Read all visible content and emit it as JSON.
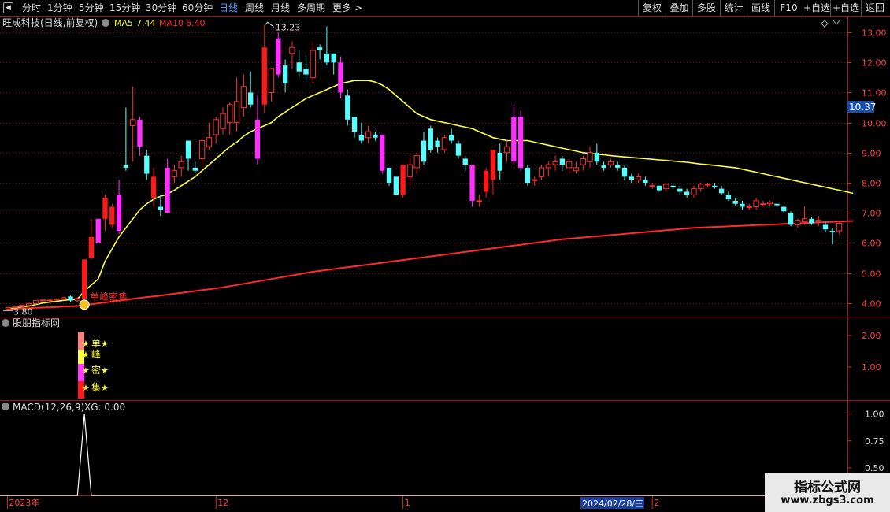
{
  "toolbar": {
    "periods": [
      "分时",
      "1分钟",
      "5分钟",
      "15分钟",
      "30分钟",
      "60分钟",
      "日线",
      "周线",
      "月线",
      "多周期",
      "更多"
    ],
    "active_period": "日线",
    "more_arrow": ">",
    "right_buttons": [
      "复权",
      "叠加",
      "多股",
      "统计",
      "画线",
      "F10",
      "+自选",
      "返回"
    ]
  },
  "chart_data": [
    {
      "type": "candlestick",
      "title": "旺成科技(日线,前复权)",
      "indicators": [
        {
          "name": "MA5",
          "value": "7.44",
          "color": "#ffff40"
        },
        {
          "name": "MA10",
          "value": "6.40",
          "color": "#ff3030"
        }
      ],
      "ylim": [
        3.6,
        13.5
      ],
      "y_ticks": [
        "13.00",
        "12.00",
        "11.00",
        "10.00",
        "9.00",
        "8.00",
        "7.00",
        "6.00",
        "5.00",
        "4.00"
      ],
      "current_price": "10.37",
      "annotations": {
        "high": "13.23",
        "low": "3.80",
        "signal": "单峰密集"
      },
      "candles": [
        [
          3.8,
          3.85,
          3.75,
          3.85
        ],
        [
          3.85,
          3.9,
          3.8,
          3.88
        ],
        [
          3.88,
          3.95,
          3.85,
          3.93
        ],
        [
          3.93,
          4.0,
          3.9,
          3.98
        ],
        [
          3.98,
          4.1,
          3.95,
          4.08
        ],
        [
          4.08,
          4.12,
          4.05,
          4.1
        ],
        [
          4.1,
          4.12,
          4.08,
          4.1
        ],
        [
          4.12,
          4.15,
          4.08,
          4.14
        ],
        [
          4.14,
          4.2,
          4.1,
          4.18
        ],
        [
          4.22,
          4.25,
          4.05,
          4.08
        ],
        [
          4.08,
          4.2,
          4.05,
          4.15
        ],
        [
          4.15,
          5.45,
          4.05,
          5.45
        ],
        [
          5.5,
          6.8,
          5.45,
          6.2
        ],
        [
          6.8,
          6.8,
          6.0,
          6.0
        ],
        [
          6.8,
          7.6,
          6.4,
          7.5
        ],
        [
          6.6,
          7.3,
          6.5,
          7.2
        ],
        [
          7.6,
          8.1,
          6.3,
          6.4
        ],
        [
          8.6,
          10.5,
          8.4,
          8.5
        ],
        [
          9.9,
          11.2,
          8.7,
          10.1
        ],
        [
          10.1,
          10.2,
          8.9,
          9.2
        ],
        [
          8.9,
          9.1,
          8.1,
          8.3
        ],
        [
          7.5,
          8.5,
          7.2,
          8.2
        ],
        [
          7.2,
          7.6,
          6.9,
          7.1
        ],
        [
          8.5,
          8.8,
          7.0,
          7.0
        ],
        [
          8.2,
          8.6,
          8.0,
          8.4
        ],
        [
          8.5,
          8.9,
          8.2,
          8.7
        ],
        [
          9.4,
          9.4,
          8.4,
          8.8
        ],
        [
          8.5,
          8.7,
          8.3,
          8.4
        ],
        [
          8.8,
          9.5,
          8.5,
          9.4
        ],
        [
          9.2,
          10.0,
          9.1,
          9.5
        ],
        [
          9.6,
          10.2,
          9.3,
          10.1
        ],
        [
          9.8,
          10.5,
          9.6,
          10.3
        ],
        [
          10.0,
          10.7,
          9.6,
          10.6
        ],
        [
          10.0,
          11.5,
          9.7,
          10.7
        ],
        [
          10.5,
          11.6,
          10.2,
          11.2
        ],
        [
          11.0,
          11.7,
          10.5,
          10.6
        ],
        [
          10.1,
          10.9,
          8.6,
          8.8
        ],
        [
          10.6,
          13.23,
          10.3,
          12.5
        ],
        [
          11.0,
          11.8,
          10.7,
          11.8
        ],
        [
          12.8,
          13.0,
          11.5,
          11.6
        ],
        [
          11.9,
          12.1,
          11.0,
          11.3
        ],
        [
          12.3,
          12.7,
          11.8,
          12.5
        ],
        [
          12.0,
          12.4,
          11.5,
          11.7
        ],
        [
          11.8,
          12.2,
          11.4,
          11.6
        ],
        [
          11.5,
          12.7,
          11.3,
          12.4
        ],
        [
          12.5,
          12.6,
          12.1,
          12.4
        ],
        [
          12.3,
          13.2,
          11.9,
          12.0
        ],
        [
          12.3,
          12.3,
          11.6,
          12.0
        ],
        [
          12.0,
          12.2,
          10.8,
          11.0
        ],
        [
          10.9,
          11.1,
          9.9,
          10.1
        ],
        [
          10.2,
          10.2,
          9.5,
          9.7
        ],
        [
          9.6,
          10.0,
          9.3,
          9.4
        ],
        [
          9.5,
          9.9,
          9.3,
          9.7
        ],
        [
          9.6,
          9.7,
          9.4,
          9.5
        ],
        [
          9.6,
          9.6,
          8.3,
          8.4
        ],
        [
          8.5,
          8.5,
          7.9,
          8.0
        ],
        [
          8.2,
          8.2,
          7.6,
          7.6
        ],
        [
          7.6,
          8.6,
          7.5,
          8.6
        ],
        [
          8.2,
          8.9,
          7.9,
          8.6
        ],
        [
          8.5,
          9.0,
          8.3,
          8.9
        ],
        [
          9.4,
          9.7,
          8.6,
          8.7
        ],
        [
          9.8,
          9.9,
          9.0,
          9.1
        ],
        [
          9.4,
          9.5,
          9.0,
          9.2
        ],
        [
          9.1,
          9.6,
          9.0,
          9.5
        ],
        [
          9.6,
          9.8,
          9.3,
          9.4
        ],
        [
          9.3,
          9.4,
          8.8,
          8.9
        ],
        [
          8.8,
          8.9,
          8.4,
          8.6
        ],
        [
          8.6,
          8.6,
          7.2,
          7.4
        ],
        [
          7.4,
          7.6,
          7.2,
          7.4
        ],
        [
          7.7,
          8.5,
          7.5,
          8.4
        ],
        [
          8.1,
          9.1,
          7.6,
          9.1
        ],
        [
          9.0,
          9.3,
          8.1,
          8.4
        ],
        [
          9.0,
          9.4,
          8.7,
          9.2
        ],
        [
          10.2,
          10.6,
          8.6,
          8.7
        ],
        [
          10.2,
          10.4,
          8.4,
          8.5
        ],
        [
          8.5,
          8.6,
          7.9,
          8.0
        ],
        [
          8.1,
          8.2,
          7.9,
          8.1
        ],
        [
          8.2,
          8.6,
          8.1,
          8.5
        ],
        [
          8.5,
          8.7,
          8.2,
          8.6
        ],
        [
          8.6,
          8.9,
          8.4,
          8.7
        ],
        [
          8.8,
          8.9,
          8.4,
          8.6
        ],
        [
          8.5,
          8.8,
          8.3,
          8.7
        ],
        [
          8.4,
          8.7,
          8.3,
          8.5
        ],
        [
          8.6,
          8.9,
          8.4,
          8.8
        ],
        [
          8.7,
          9.2,
          8.5,
          9.0
        ],
        [
          9.0,
          9.3,
          8.6,
          8.7
        ],
        [
          8.6,
          8.7,
          8.4,
          8.5
        ],
        [
          8.6,
          8.8,
          8.5,
          8.7
        ],
        [
          8.6,
          8.7,
          8.4,
          8.5
        ],
        [
          8.5,
          8.6,
          8.1,
          8.2
        ],
        [
          8.2,
          8.3,
          8.0,
          8.1
        ],
        [
          8.1,
          8.3,
          8.0,
          8.2
        ],
        [
          8.1,
          8.2,
          7.9,
          8.0
        ],
        [
          7.9,
          8.0,
          7.8,
          7.9
        ],
        [
          7.9,
          7.9,
          7.7,
          7.75
        ],
        [
          7.8,
          8.0,
          7.7,
          7.95
        ],
        [
          7.9,
          8.0,
          7.8,
          7.85
        ],
        [
          7.8,
          7.9,
          7.6,
          7.7
        ],
        [
          7.7,
          7.8,
          7.5,
          7.6
        ],
        [
          7.6,
          7.9,
          7.5,
          7.8
        ],
        [
          7.8,
          8.0,
          7.7,
          7.95
        ],
        [
          7.95,
          8.0,
          7.85,
          7.95
        ],
        [
          7.9,
          8.0,
          7.8,
          7.85
        ],
        [
          7.8,
          7.9,
          7.6,
          7.65
        ],
        [
          7.6,
          7.7,
          7.4,
          7.45
        ],
        [
          7.4,
          7.5,
          7.25,
          7.3
        ],
        [
          7.3,
          7.4,
          7.1,
          7.2
        ],
        [
          7.2,
          7.3,
          7.1,
          7.2
        ],
        [
          7.2,
          7.5,
          7.1,
          7.4
        ],
        [
          7.3,
          7.4,
          7.2,
          7.3
        ],
        [
          7.3,
          7.4,
          7.2,
          7.35
        ],
        [
          7.3,
          7.35,
          7.2,
          7.25
        ],
        [
          7.2,
          7.25,
          7.0,
          7.05
        ],
        [
          7.0,
          7.05,
          6.55,
          6.6
        ],
        [
          6.6,
          6.8,
          6.5,
          6.75
        ],
        [
          6.7,
          7.2,
          6.6,
          6.8
        ],
        [
          6.8,
          6.85,
          6.6,
          6.65
        ],
        [
          6.7,
          6.9,
          6.55,
          6.75
        ],
        [
          6.6,
          6.7,
          6.35,
          6.45
        ],
        [
          6.4,
          6.5,
          5.95,
          6.35
        ],
        [
          6.4,
          6.7,
          6.3,
          6.65
        ]
      ],
      "ma5": [
        3.81,
        3.84,
        3.87,
        3.9,
        3.95,
        4.0,
        4.03,
        4.06,
        4.09,
        4.11,
        4.13,
        4.4,
        4.6,
        4.8,
        5.4,
        5.8,
        6.2,
        6.5,
        6.8,
        7.1,
        7.3,
        7.45,
        7.55,
        7.62,
        7.75,
        7.9,
        8.05,
        8.2,
        8.4,
        8.6,
        8.8,
        9.0,
        9.2,
        9.35,
        9.55,
        9.7,
        9.8,
        9.9,
        10.0,
        10.2,
        10.35,
        10.5,
        10.65,
        10.8,
        10.9,
        11.0,
        11.1,
        11.2,
        11.3,
        11.35,
        11.4,
        11.4,
        11.4,
        11.35,
        11.25,
        11.1,
        10.9,
        10.7,
        10.5,
        10.3,
        10.2,
        10.1,
        10.05,
        10.0,
        9.95,
        9.9,
        9.85,
        9.8,
        9.7,
        9.6,
        9.5,
        9.45,
        9.4,
        9.4,
        9.4,
        9.4,
        9.35,
        9.3,
        9.25,
        9.2,
        9.15,
        9.1,
        9.05,
        9.0,
        8.98,
        8.95,
        8.93,
        8.9,
        8.88,
        8.86,
        8.84,
        8.82,
        8.8,
        8.78,
        8.76,
        8.74,
        8.72,
        8.7,
        8.68,
        8.65,
        8.62,
        8.6,
        8.58,
        8.55,
        8.52,
        8.5,
        8.45,
        8.4,
        8.35,
        8.3,
        8.25,
        8.2,
        8.15,
        8.1,
        8.05,
        8.0,
        7.95,
        7.9,
        7.85,
        7.8,
        7.75,
        7.7,
        7.65
      ],
      "ma10": [
        3.8,
        3.81,
        3.82,
        3.83,
        3.84,
        3.85,
        3.86,
        3.87,
        3.88,
        3.89,
        3.9,
        3.93,
        3.96,
        3.99,
        4.02,
        4.05,
        4.08,
        4.11,
        4.14,
        4.17,
        4.2,
        4.22,
        4.25,
        4.28,
        4.31,
        4.34,
        4.37,
        4.4,
        4.43,
        4.46,
        4.49,
        4.52,
        4.56,
        4.6,
        4.64,
        4.68,
        4.72,
        4.76,
        4.8,
        4.84,
        4.88,
        4.92,
        4.96,
        5.0,
        5.04,
        5.07,
        5.1,
        5.13,
        5.16,
        5.19,
        5.22,
        5.25,
        5.28,
        5.31,
        5.34,
        5.37,
        5.4,
        5.43,
        5.46,
        5.49,
        5.52,
        5.55,
        5.58,
        5.61,
        5.64,
        5.67,
        5.7,
        5.73,
        5.76,
        5.79,
        5.82,
        5.85,
        5.88,
        5.91,
        5.94,
        5.97,
        6.0,
        6.03,
        6.06,
        6.09,
        6.12,
        6.14,
        6.16,
        6.18,
        6.2,
        6.22,
        6.24,
        6.26,
        6.28,
        6.3,
        6.32,
        6.34,
        6.36,
        6.38,
        6.4,
        6.42,
        6.44,
        6.46,
        6.48,
        6.5,
        6.51,
        6.52,
        6.53,
        6.54,
        6.55,
        6.56,
        6.57,
        6.58,
        6.59,
        6.6,
        6.61,
        6.62,
        6.63,
        6.64,
        6.65,
        6.66,
        6.67,
        6.68,
        6.69,
        6.7,
        6.71,
        6.72,
        6.73
      ]
    },
    {
      "type": "signal",
      "title": "股朋指标网",
      "y_ticks": [
        "2.00",
        "1.00"
      ],
      "signals": [
        "单",
        "峰",
        "密",
        "集"
      ],
      "star": "★"
    },
    {
      "type": "line",
      "title": "MACD(12,26,9)",
      "series_label": "XG: 0.00",
      "y_ticks": [
        "1.00",
        "0.75",
        "0.50"
      ],
      "spike_index": 11
    }
  ],
  "x_axis": {
    "labels": [
      "2023年",
      "12",
      "1",
      "2"
    ],
    "cursor_date": "2024/02/28/三"
  },
  "watermark": {
    "line1": "指标公式网",
    "line2": "www.zbgs3.com"
  }
}
